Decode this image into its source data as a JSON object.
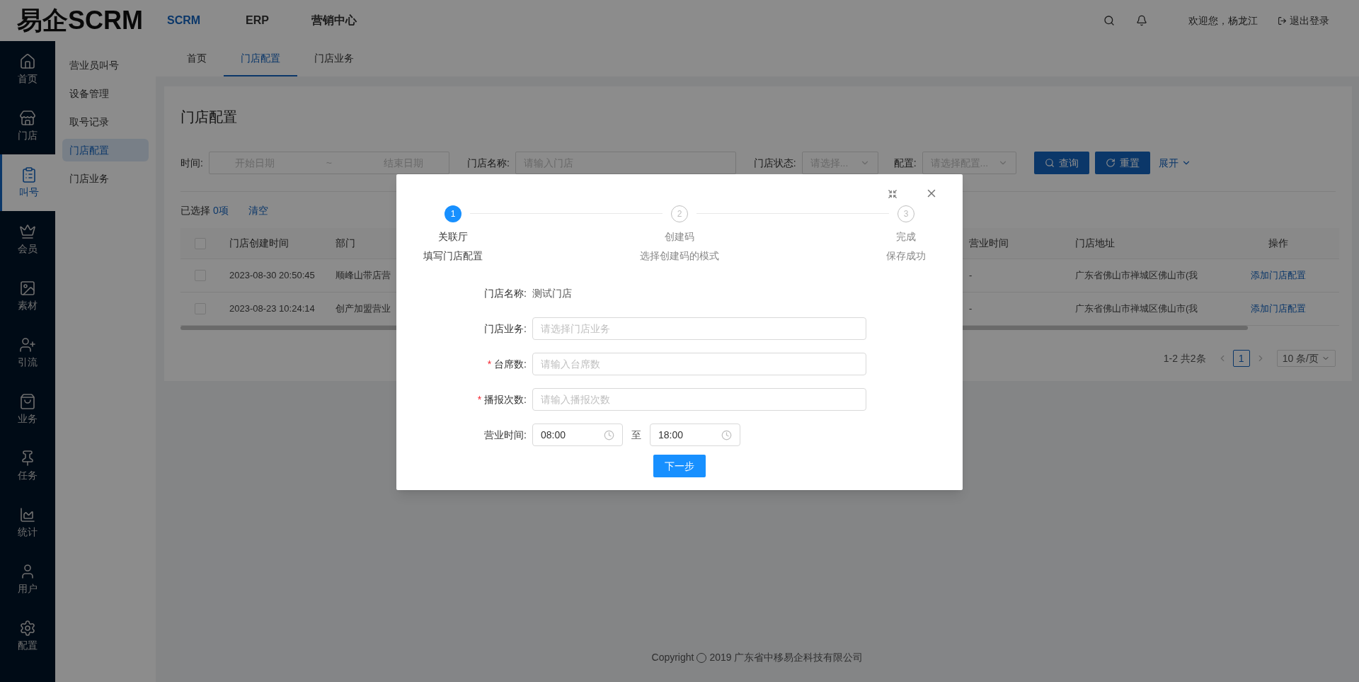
{
  "header": {
    "logo": "易企SCRM",
    "nav": [
      {
        "label": "SCRM",
        "selected": true
      },
      {
        "label": "ERP",
        "selected": false
      },
      {
        "label": "营销中心",
        "selected": false
      }
    ],
    "greeting": "欢迎您，杨龙江",
    "logout": "退出登录"
  },
  "sidebar": {
    "items": [
      {
        "label": "首页",
        "selected": false
      },
      {
        "label": "门店",
        "selected": false
      },
      {
        "label": "叫号",
        "selected": true
      },
      {
        "label": "会员",
        "selected": false
      },
      {
        "label": "素材",
        "selected": false
      },
      {
        "label": "引流",
        "selected": false
      },
      {
        "label": "业务",
        "selected": false
      },
      {
        "label": "任务",
        "selected": false
      },
      {
        "label": "统计",
        "selected": false
      },
      {
        "label": "用户",
        "selected": false
      },
      {
        "label": "配置",
        "selected": false
      }
    ]
  },
  "submenu": {
    "items": [
      {
        "label": "营业员叫号",
        "selected": false
      },
      {
        "label": "设备管理",
        "selected": false
      },
      {
        "label": "取号记录",
        "selected": false
      },
      {
        "label": "门店配置",
        "selected": true
      },
      {
        "label": "门店业务",
        "selected": false
      }
    ]
  },
  "tabs": [
    {
      "label": "首页",
      "selected": false
    },
    {
      "label": "门店配置",
      "selected": true
    },
    {
      "label": "门店业务",
      "selected": false
    }
  ],
  "page": {
    "title": "门店配置",
    "filters": [
      {
        "kind": "daterange",
        "label": "时间:",
        "start": "开始日期",
        "separator": "~",
        "end": "结束日期"
      },
      {
        "kind": "input",
        "label": "门店名称:",
        "placeholder": "请输入门店"
      },
      {
        "kind": "select",
        "label": "门店状态:",
        "placeholder": "请选择..."
      },
      {
        "kind": "select",
        "label": "配置:",
        "placeholder": "请选择配置..."
      }
    ],
    "buttons": [
      {
        "kind": "search",
        "label": "查询"
      },
      {
        "kind": "reset",
        "label": "重置"
      }
    ],
    "expand": "展开",
    "selection": {
      "prefix": "已选择",
      "count": "0项",
      "clear": "清空"
    },
    "table": {
      "header_checked": false,
      "columns": [
        "门店创建时间",
        "部门",
        "营业时间",
        "门店地址",
        "操作"
      ],
      "rows": [
        {
          "checked": false,
          "cells": [
            "2023-08-30 20:50:45",
            "顺峰山带店营",
            "-",
            "广东省佛山市禅城区佛山市(我",
            "添加门店配置"
          ]
        },
        {
          "checked": false,
          "cells": [
            "2023-08-23 10:24:14",
            "创产加盟营业",
            "-",
            "广东省佛山市禅城区佛山市(我",
            "添加门店配置"
          ]
        }
      ]
    },
    "pagination": {
      "summary": "1-2 共2条",
      "pages": [
        {
          "label": "1",
          "selected": true
        }
      ],
      "size": "10 条/页"
    }
  },
  "footer": {
    "copyright": "Copyright",
    "year_owner": "2019 广东省中移易企科技有限公司"
  },
  "modal": {
    "steps": [
      {
        "number": "1",
        "title": "关联厅",
        "description": "填写门店配置",
        "selected": true
      },
      {
        "number": "2",
        "title": "创建码",
        "description": "选择创建码的模式",
        "selected": false
      },
      {
        "number": "3",
        "title": "完成",
        "description": "保存成功",
        "selected": false
      }
    ],
    "fields": [
      {
        "kind": "text",
        "label": "门店名称:",
        "value": "测试门店"
      },
      {
        "kind": "input",
        "label": "门店业务:",
        "placeholder": "请选择门店业务"
      },
      {
        "kind": "input",
        "label": "台席数:",
        "placeholder": "请输入台席数",
        "required_mark": "*"
      },
      {
        "kind": "input",
        "label": "播报次数:",
        "placeholder": "请输入播报次数",
        "required_mark": "*"
      },
      {
        "kind": "timerange",
        "label": "营业时间:",
        "start": "08:00",
        "separator": "至",
        "end": "18:00"
      }
    ],
    "next": "下一步"
  }
}
